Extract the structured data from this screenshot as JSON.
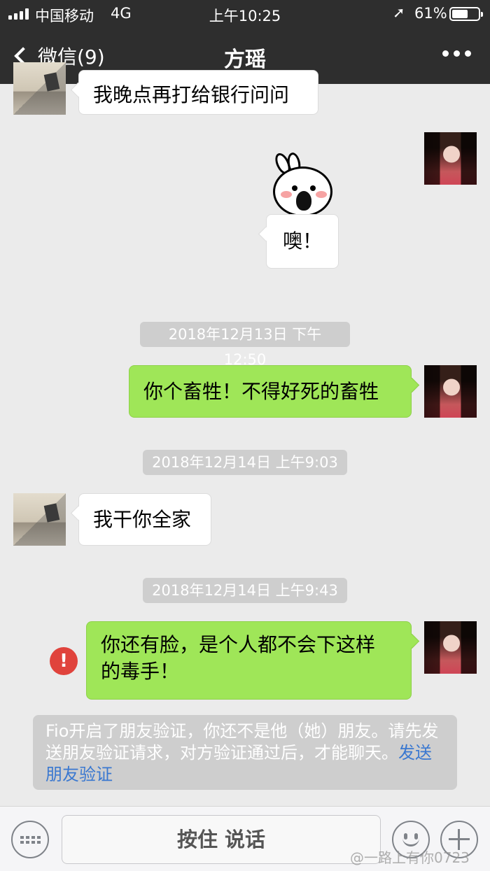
{
  "status_bar": {
    "carrier": "中国移动",
    "network": "4G",
    "time": "上午10:25",
    "battery_percent": "61%",
    "battery_level": 0.61,
    "location_icon": "location-arrow-icon"
  },
  "nav": {
    "back_label": "微信(9)",
    "title": "方瑶",
    "more_icon": "more-dots-icon"
  },
  "messages": {
    "m1": "我晚点再打给银行问问",
    "sticker_caption": "噢！",
    "ts1": "2018年12月13日 下午12:50",
    "m2": "你个畜牲！不得好死的畜牲",
    "ts2": "2018年12月14日 上午9:03",
    "m3": "我干你全家",
    "ts3": "2018年12月14日 上午9:43",
    "m4_line1": "你还有脸，是个人都不会下这样",
    "m4_line2": "的毒手！",
    "failed_icon": "!"
  },
  "system_notice": {
    "text": "Fio开启了朋友验证，你还不是他（她）朋友。请先发送朋友验证请求，对方验证通过后，才能聊天。",
    "link": "发送朋友验证"
  },
  "input_bar": {
    "hold_to_talk": "按住 说话"
  },
  "watermark": "@一路上有你0723",
  "colors": {
    "nav_bg": "#2e2e2e",
    "chat_bg": "#ebebeb",
    "sent_bubble": "#9fe658",
    "received_bubble": "#ffffff",
    "error_red": "#e0433c",
    "link_blue": "#3a78d0"
  }
}
